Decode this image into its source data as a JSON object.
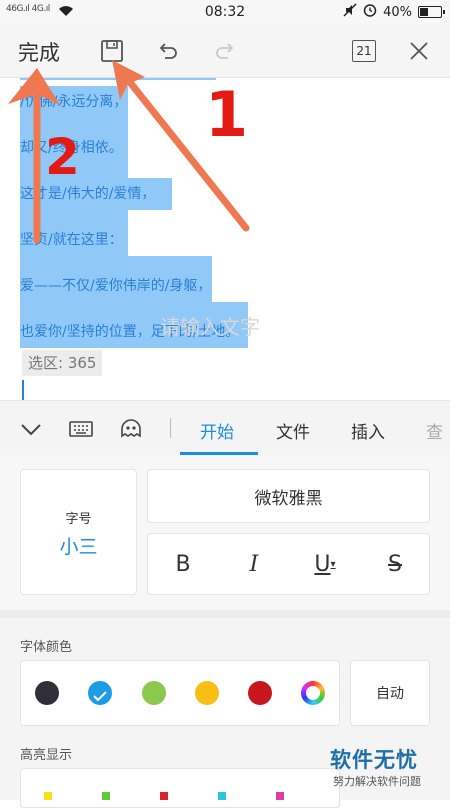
{
  "status_bar": {
    "carrier": "46G.ıl 4G.ıl",
    "time": "08:32",
    "battery": "40%",
    "battery_level": 0.4
  },
  "toolbar": {
    "done_label": "完成",
    "page_count": "21"
  },
  "document": {
    "lines": [
      "/仿佛/永远分离，",
      "却又/终身相依。",
      "这才是/伟大的/爱情，",
      "坚贞/就在这里：",
      "爱——不仅/爱你伟岸的/身躯，",
      "也爱你/坚持的位置，足下的/土地。"
    ],
    "selection_info": "选区: 365",
    "placeholder": "请输入文字"
  },
  "annotations": {
    "label_1": "1",
    "label_2": "2",
    "arrow_color": "#f07850"
  },
  "tabs": {
    "items": [
      "开始",
      "文件",
      "插入",
      "查"
    ],
    "active": "开始"
  },
  "font_panel": {
    "size_label": "字号",
    "size_value": "小三",
    "font_name": "微软雅黑",
    "bold": "B",
    "italic": "I",
    "underline": "U",
    "strike": "S"
  },
  "color_panel": {
    "font_color_label": "字体颜色",
    "highlight_label": "高亮显示",
    "auto_label": "自动",
    "colors": [
      "#2f3037",
      "#1a9de4",
      "#8cc84b",
      "#f7be13",
      "#c8161d",
      "rainbow"
    ],
    "selected_color": "#1a9de4"
  },
  "watermark": {
    "title": "软件无忧",
    "subtitle": "努力解决软件问题"
  }
}
